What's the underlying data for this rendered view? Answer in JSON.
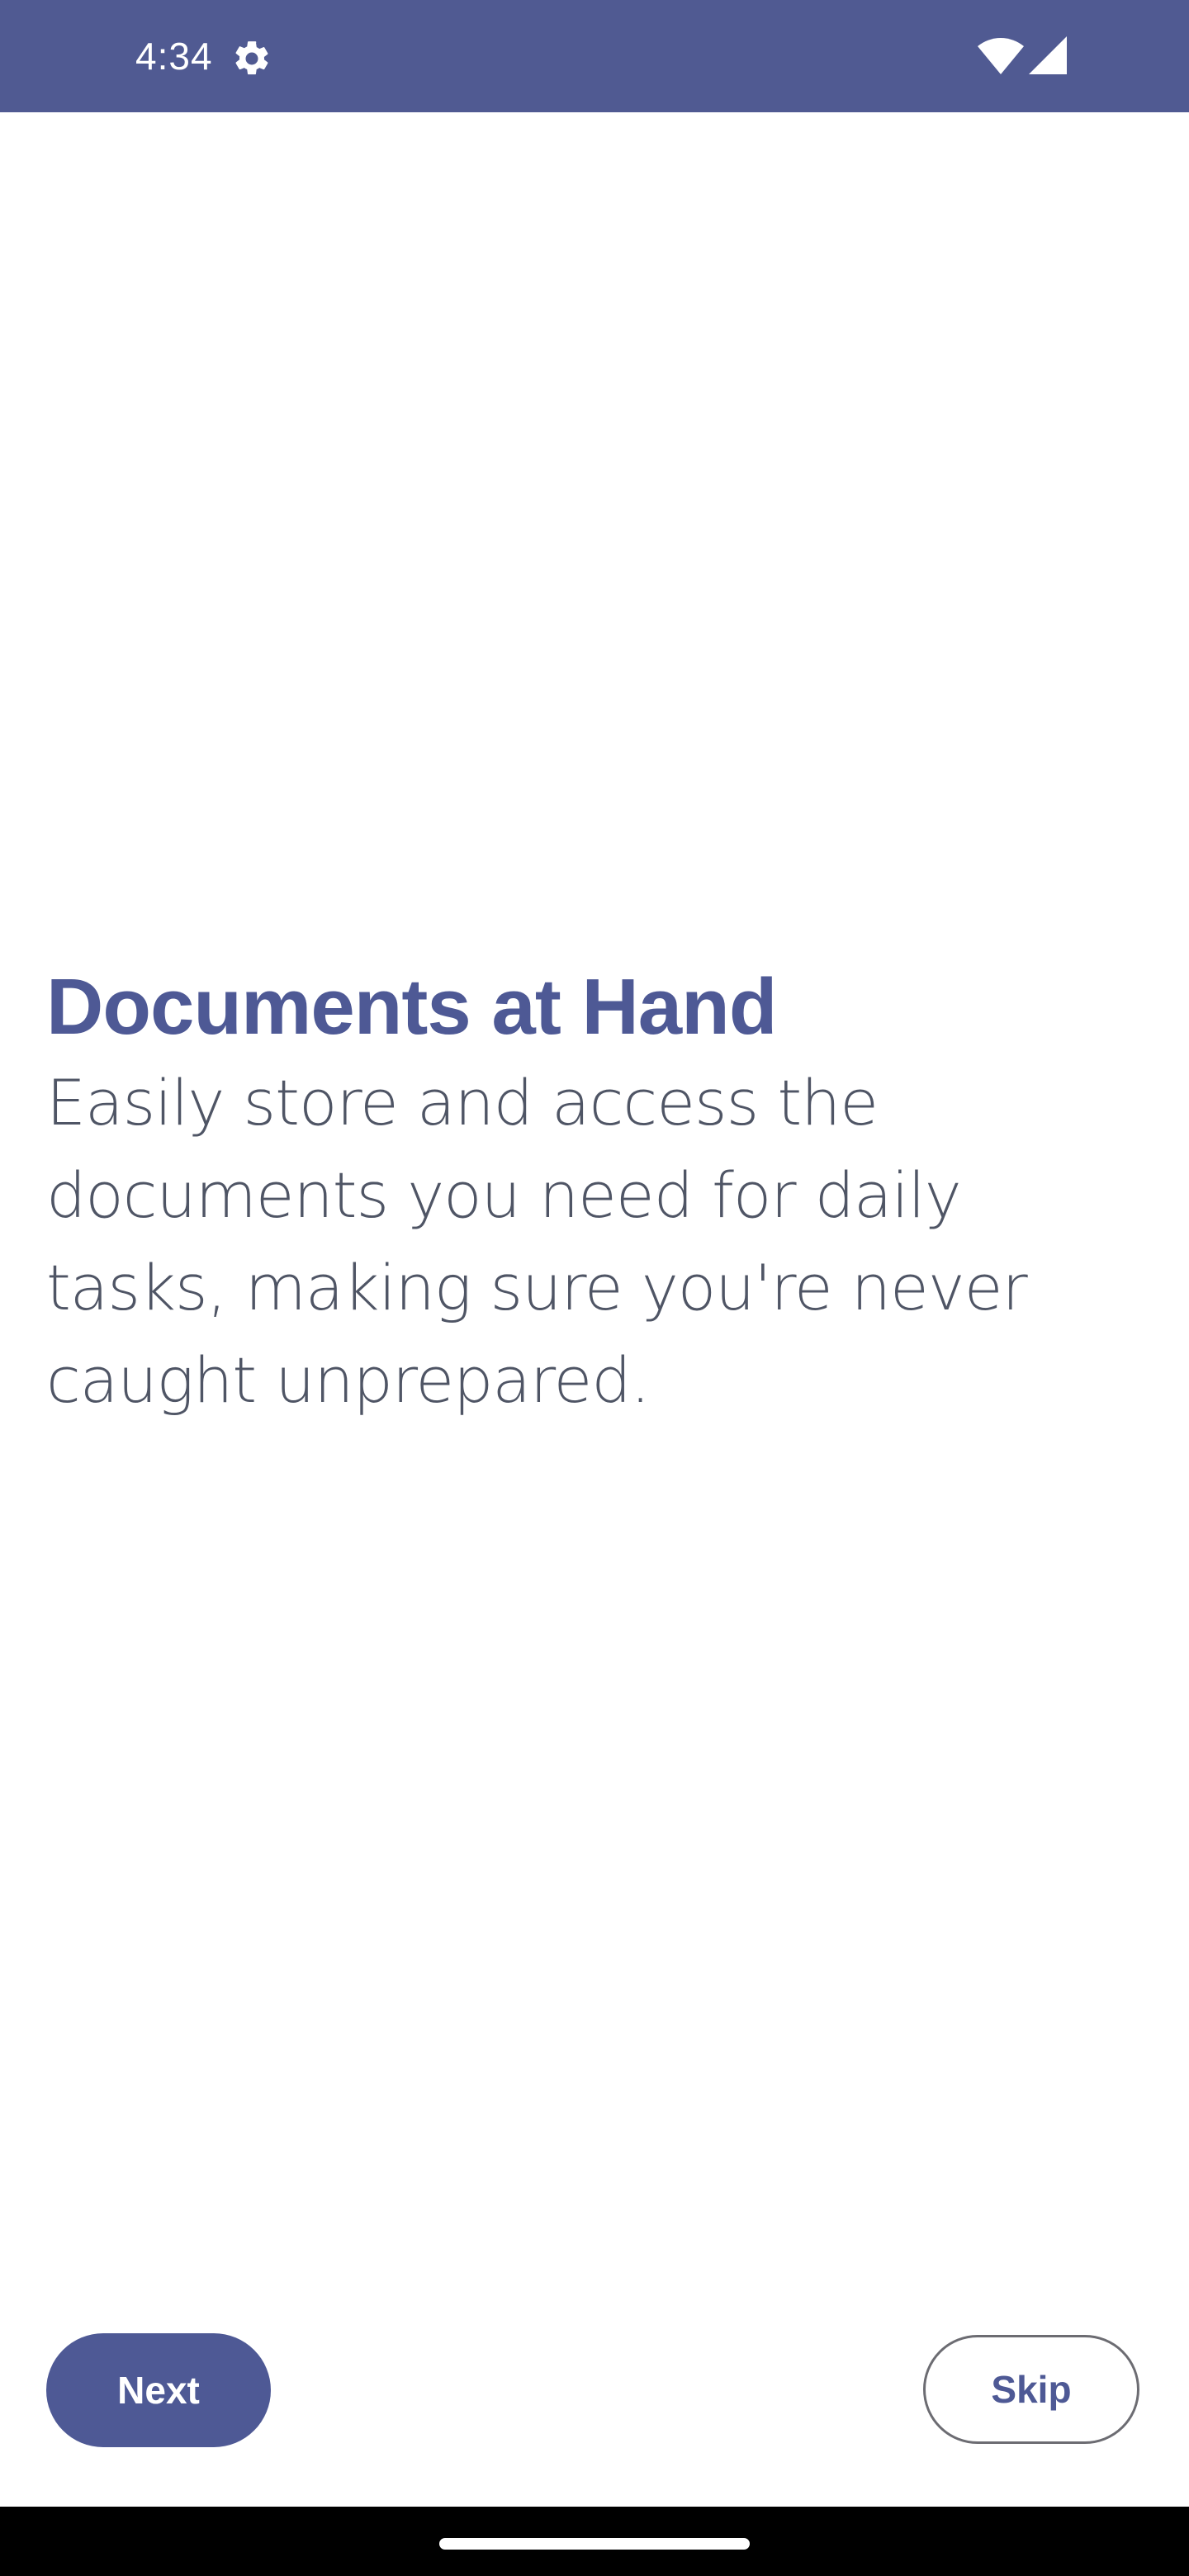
{
  "status_bar": {
    "time": "4:34",
    "icons": [
      "gear-icon",
      "wifi-icon",
      "cell-signal-icon"
    ],
    "background_color": "#505a92"
  },
  "onboarding": {
    "title": "Documents at Hand",
    "description": "Easily store and access the documents you need for daily tasks, making sure you're never caught unprepared.",
    "accent_color": "#4e5995"
  },
  "actions": {
    "next_label": "Next",
    "skip_label": "Skip"
  }
}
